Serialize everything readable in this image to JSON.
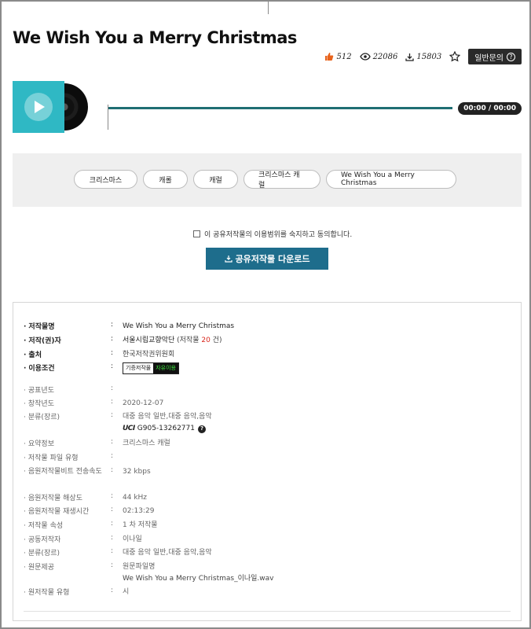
{
  "title": "We Wish You a Merry Christmas",
  "stats": {
    "likes": "512",
    "views": "22086",
    "downloads": "15803"
  },
  "inquiry_label": "일반문의",
  "player": {
    "time": "00:00 / 00:00"
  },
  "tags": [
    "크리스마스",
    "캐롤",
    "캐럴",
    "크리스마스 캐럴",
    "We Wish You a Merry Christmas"
  ],
  "agree_text": "이 공유저작물의 이용범위를 숙지하고 동의합니다.",
  "download_label": "공유저작물 다운로드",
  "info": {
    "work_name": {
      "label": "저작물명",
      "value": "We Wish You a Merry Christmas"
    },
    "author": {
      "label": "저작(권)자",
      "value": "서울시립교향악단",
      "count_prefix": "(저작물 ",
      "count": "20",
      "count_suffix": " 건)"
    },
    "source": {
      "label": "출처",
      "value": "한국저작권위원회"
    },
    "usage": {
      "label": "이용조건",
      "badge_left": "기증저작물",
      "badge_right": "자유이용"
    },
    "pub_year": {
      "label": "공표년도",
      "value": ""
    },
    "created": {
      "label": "창작년도",
      "value": "2020-12-07"
    },
    "genre": {
      "label": "분류(장르)",
      "value": "대중 음악 일반,대중 음악,음악",
      "uci_logo": "UCI",
      "uci_code": "G905-13262771"
    },
    "summary": {
      "label": "요약정보",
      "value": "크리스마스 캐럴"
    },
    "file_type": {
      "label": "저작물 파일 유형",
      "value": ""
    },
    "bitrate": {
      "label": "음원저작물비트 전송속도",
      "value": "32 kbps"
    },
    "resolution": {
      "label": "음원저작물 해상도",
      "value": "44 kHz"
    },
    "duration": {
      "label": "음원저작물 재생시간",
      "value": "02:13:29"
    },
    "attribute": {
      "label": "저작물 속성",
      "value": "1 차 저작물"
    },
    "co_author": {
      "label": "공동저작자",
      "value": "이나일"
    },
    "genre2": {
      "label": "분류(장르)",
      "value": "대중 음악 일반,대중 음악,음악"
    },
    "original": {
      "label": "원문제공",
      "value": "원문파일명",
      "file": "We Wish You a Merry Christmas_이나일.wav"
    },
    "orig_type": {
      "label": "원저작물 유형",
      "value": "시"
    }
  },
  "colors": {
    "accent": "#1e6d8c",
    "album": "#2fb8c4",
    "track": "#1f6e73",
    "count": "#d9261c"
  }
}
